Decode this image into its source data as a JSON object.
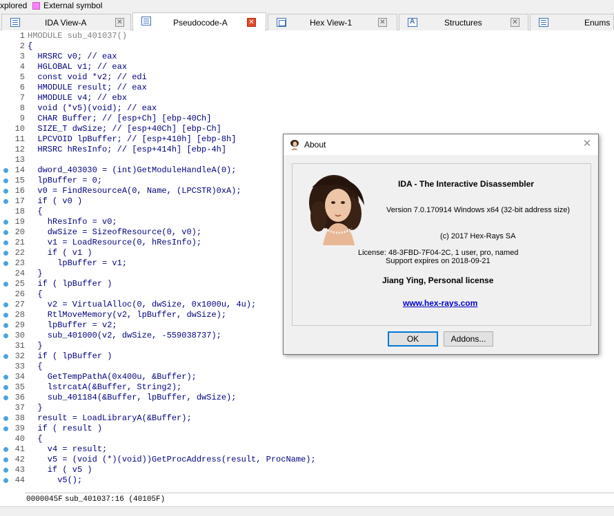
{
  "legend": {
    "text_1": "xplored",
    "text_2": "External symbol",
    "swatch_color": "#ff80ff"
  },
  "tabs": [
    {
      "label": "IDA View-A",
      "icon": "disassembly-icon",
      "active": false,
      "close": "✕"
    },
    {
      "label": "Pseudocode-A",
      "icon": "pseudocode-icon",
      "active": true,
      "close": "✕"
    },
    {
      "label": "Hex View-1",
      "icon": "hex-view-icon",
      "active": false,
      "close": "✕"
    },
    {
      "label": "Structures",
      "icon": "structures-icon",
      "active": false,
      "close": "✕"
    },
    {
      "label": "Enums",
      "icon": "enums-icon",
      "active": false,
      "close": ""
    }
  ],
  "code": [
    {
      "n": "1",
      "bp": false,
      "text": "HMODULE sub_401037()"
    },
    {
      "n": "2",
      "bp": false,
      "text": "{"
    },
    {
      "n": "3",
      "bp": false,
      "text": "  HRSRC v0; // eax"
    },
    {
      "n": "4",
      "bp": false,
      "text": "  HGLOBAL v1; // eax"
    },
    {
      "n": "5",
      "bp": false,
      "text": "  const void *v2; // edi"
    },
    {
      "n": "6",
      "bp": false,
      "text": "  HMODULE result; // eax"
    },
    {
      "n": "7",
      "bp": false,
      "text": "  HMODULE v4; // ebx"
    },
    {
      "n": "8",
      "bp": false,
      "text": "  void (*v5)(void); // eax"
    },
    {
      "n": "9",
      "bp": false,
      "text": "  CHAR Buffer; // [esp+Ch] [ebp-40Ch]"
    },
    {
      "n": "10",
      "bp": false,
      "text": "  SIZE_T dwSize; // [esp+40Ch] [ebp-Ch]"
    },
    {
      "n": "11",
      "bp": false,
      "text": "  LPCVOID lpBuffer; // [esp+410h] [ebp-8h]"
    },
    {
      "n": "12",
      "bp": false,
      "text": "  HRSRC hResInfo; // [esp+414h] [ebp-4h]"
    },
    {
      "n": "13",
      "bp": false,
      "text": ""
    },
    {
      "n": "14",
      "bp": true,
      "text": "  dword_403030 = (int)GetModuleHandleA(0);"
    },
    {
      "n": "15",
      "bp": true,
      "text": "  lpBuffer = 0;"
    },
    {
      "n": "16",
      "bp": true,
      "text": "  v0 = FindResourceA(0, Name, (LPCSTR)0xA);"
    },
    {
      "n": "17",
      "bp": true,
      "text": "  if ( v0 )"
    },
    {
      "n": "18",
      "bp": false,
      "text": "  {"
    },
    {
      "n": "19",
      "bp": true,
      "text": "    hResInfo = v0;"
    },
    {
      "n": "20",
      "bp": true,
      "text": "    dwSize = SizeofResource(0, v0);"
    },
    {
      "n": "21",
      "bp": true,
      "text": "    v1 = LoadResource(0, hResInfo);"
    },
    {
      "n": "22",
      "bp": true,
      "text": "    if ( v1 )"
    },
    {
      "n": "23",
      "bp": true,
      "text": "      lpBuffer = v1;"
    },
    {
      "n": "24",
      "bp": false,
      "text": "  }"
    },
    {
      "n": "25",
      "bp": true,
      "text": "  if ( lpBuffer )"
    },
    {
      "n": "26",
      "bp": false,
      "text": "  {"
    },
    {
      "n": "27",
      "bp": true,
      "text": "    v2 = VirtualAlloc(0, dwSize, 0x1000u, 4u);"
    },
    {
      "n": "28",
      "bp": true,
      "text": "    RtlMoveMemory(v2, lpBuffer, dwSize);"
    },
    {
      "n": "29",
      "bp": true,
      "text": "    lpBuffer = v2;"
    },
    {
      "n": "30",
      "bp": true,
      "text": "    sub_401000(v2, dwSize, -559038737);"
    },
    {
      "n": "31",
      "bp": false,
      "text": "  }"
    },
    {
      "n": "32",
      "bp": true,
      "text": "  if ( lpBuffer )"
    },
    {
      "n": "33",
      "bp": false,
      "text": "  {"
    },
    {
      "n": "34",
      "bp": true,
      "text": "    GetTempPathA(0x400u, &Buffer);"
    },
    {
      "n": "35",
      "bp": true,
      "text": "    lstrcatA(&Buffer, String2);"
    },
    {
      "n": "36",
      "bp": true,
      "text": "    sub_401184(&Buffer, lpBuffer, dwSize);"
    },
    {
      "n": "37",
      "bp": false,
      "text": "  }"
    },
    {
      "n": "38",
      "bp": true,
      "text": "  result = LoadLibraryA(&Buffer);"
    },
    {
      "n": "39",
      "bp": true,
      "text": "  if ( result )"
    },
    {
      "n": "40",
      "bp": false,
      "text": "  {"
    },
    {
      "n": "41",
      "bp": true,
      "text": "    v4 = result;"
    },
    {
      "n": "42",
      "bp": true,
      "text": "    v5 = (void (*)(void))GetProcAddress(result, ProcName);"
    },
    {
      "n": "43",
      "bp": true,
      "text": "    if ( v5 )"
    },
    {
      "n": "44",
      "bp": true,
      "text": "      v5();"
    }
  ],
  "status": {
    "address": "0000045F",
    "location": "sub_401037:16 (40105F)"
  },
  "about": {
    "title": "About",
    "product": "IDA - The Interactive Disassembler",
    "version": "Version 7.0.170914 Windows x64 (32-bit address size)",
    "copyright": "(c) 2017 Hex-Rays SA",
    "license": "License: 48-3FBD-7F04-2C, 1 user, pro, named",
    "support": "Support expires on 2018-09-21",
    "owner": "Jiang Ying, Personal license",
    "link": "www.hex-rays.com",
    "ok_label": "OK",
    "addons_label": "Addons...",
    "close_glyph": "✕"
  },
  "colors": {
    "code_text": "#000080",
    "breakpoint": "#4aa3e0",
    "active_close": "#e04a2a",
    "link": "#0000cc"
  }
}
